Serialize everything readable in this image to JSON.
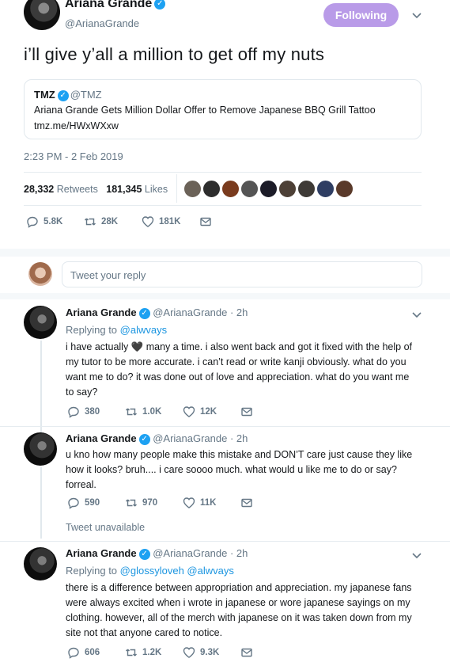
{
  "main_tweet": {
    "name": "Ariana Grande",
    "handle": "@ArianaGrande",
    "follow_label": "Following",
    "text": "i’ll give y’all a million to get off my nuts",
    "quote": {
      "source": "TMZ",
      "handle": "@TMZ",
      "text": "Ariana Grande Gets Million Dollar Offer to Remove Japanese BBQ Grill Tattoo",
      "link": "tmz.me/HWxWXxw"
    },
    "timestamp": "2:23 PM - 2 Feb 2019",
    "retweets_count": "28,332",
    "retweets_label": "Retweets",
    "likes_count": "181,345",
    "likes_label": "Likes",
    "actions": {
      "replies": "5.8K",
      "retweets": "28K",
      "likes": "181K"
    }
  },
  "reply_box": {
    "placeholder": "Tweet your reply"
  },
  "replies": [
    {
      "name": "Ariana Grande",
      "handle": "@ArianaGrande",
      "time": "· 2h",
      "replying_prefix": "Replying to",
      "replying_to": "@alwvays",
      "lines": [
        "i have actually 🖤 many a time. i also went back and got it fixed with the help of",
        "my tutor to be more accurate. i can’t read or write kanji obviously. what do you",
        "want me to do? it was done out of love and appreciation. what do you want me",
        "to say?"
      ],
      "actions": {
        "replies": "380",
        "retweets": "1.0K",
        "likes": "12K"
      }
    },
    {
      "name": "Ariana Grande",
      "handle": "@ArianaGrande",
      "time": "· 2h",
      "lines": [
        "u kno how many people make this mistake and DON’T care just cause they like",
        "how it looks? bruh.... i care soooo much. what would u like me to do or say?",
        "forreal."
      ],
      "actions": {
        "replies": "590",
        "retweets": "970",
        "likes": "11K"
      }
    },
    {
      "name": "Ariana Grande",
      "handle": "@ArianaGrande",
      "time": "· 2h",
      "replying_prefix": "Replying to",
      "replying_to": "@glossyloveh @alwvays",
      "lines": [
        "there is a difference between appropriation and appreciation. my japanese fans",
        "were always excited when i wrote in japanese or wore japanese sayings on my",
        "clothing. however, all of the merch with japanese on it was taken down from my",
        "site not that anyone cared to notice."
      ],
      "actions": {
        "replies": "606",
        "retweets": "1.2K",
        "likes": "9.3K"
      }
    }
  ],
  "tweet_unavailable": "Tweet unavailable",
  "colors": {
    "accent": "#1da1f2",
    "following_button": "#b99be8",
    "muted": "#657786",
    "link": "#1b95e0"
  }
}
